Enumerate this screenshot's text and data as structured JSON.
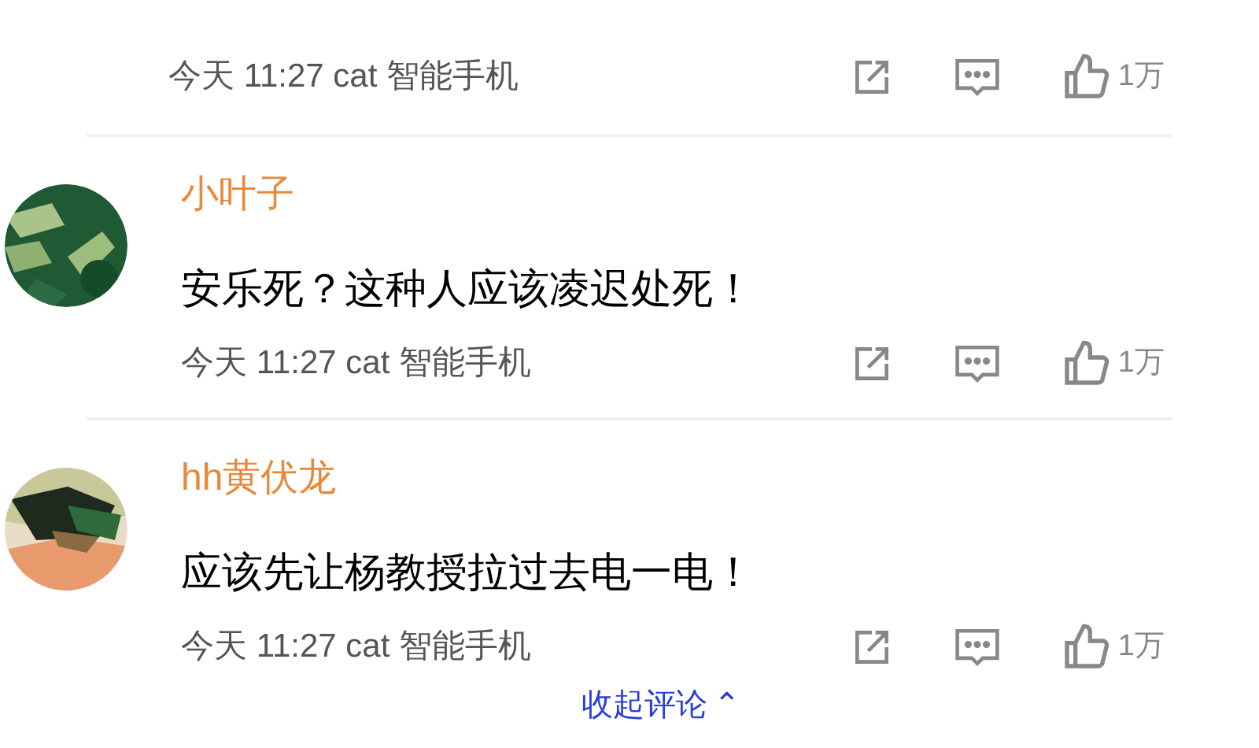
{
  "top_comment": {
    "meta": "今天 11:27 cat 智能手机",
    "likes": "1万"
  },
  "comments": [
    {
      "author": "小叶子",
      "text": "安乐死？这种人应该凌迟处死！",
      "meta": "今天 11:27 cat 智能手机",
      "likes": "1万"
    },
    {
      "author": "hh黄伏龙",
      "text": "应该先让杨教授拉过去电一电！",
      "meta": "今天 11:27 cat 智能手机",
      "likes": "1万"
    }
  ],
  "collapse_link": {
    "label": "收起评论",
    "icon": "⌃"
  }
}
